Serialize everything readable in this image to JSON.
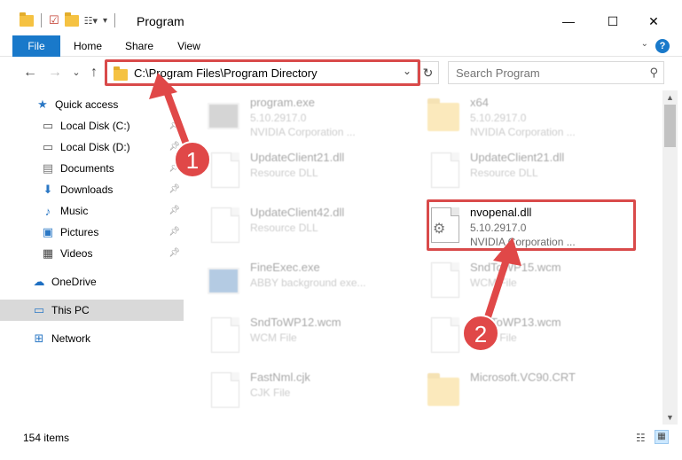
{
  "window": {
    "title": "Program",
    "minimize": "—",
    "maximize": "☐",
    "close": "✕"
  },
  "ribbon": {
    "tabs": [
      {
        "label": "File"
      },
      {
        "label": "Home"
      },
      {
        "label": "Share"
      },
      {
        "label": "View"
      }
    ],
    "help": "?"
  },
  "navigation": {
    "back": "←",
    "forward": "→",
    "recent": "⌄",
    "up": "↑"
  },
  "address_bar": {
    "path": "C:\\Program Files\\Program Directory",
    "refresh": "↻"
  },
  "search": {
    "placeholder": "Search Program"
  },
  "nav_pane": {
    "items": [
      {
        "label": "Quick access",
        "icon": "star-icon",
        "pinned": false
      },
      {
        "label": "Local Disk (C:)",
        "icon": "drive-icon",
        "pinned": true
      },
      {
        "label": "Local Disk (D:)",
        "icon": "drive-icon",
        "pinned": true
      },
      {
        "label": "Documents",
        "icon": "document-icon",
        "pinned": true
      },
      {
        "label": "Downloads",
        "icon": "download-icon",
        "pinned": true
      },
      {
        "label": "Music",
        "icon": "music-icon",
        "pinned": true
      },
      {
        "label": "Pictures",
        "icon": "pictures-icon",
        "pinned": true
      },
      {
        "label": "Videos",
        "icon": "video-icon",
        "pinned": true
      },
      {
        "label": "OneDrive",
        "icon": "cloud-icon",
        "pinned": false
      },
      {
        "label": "This PC",
        "icon": "computer-icon",
        "pinned": false,
        "selected": true
      },
      {
        "label": "Network",
        "icon": "network-icon",
        "pinned": false
      }
    ]
  },
  "files": [
    {
      "name": "program.exe",
      "line2": "5.10.2917.0",
      "line3": "NVIDIA Corporation ...",
      "icon": "exe-icon",
      "faded": true
    },
    {
      "name": "x64",
      "line2": "5.10.2917.0",
      "line3": "NVIDIA Corporation ...",
      "icon": "folder-icon",
      "faded": true
    },
    {
      "name": "UpdateClient21.dll",
      "line2": "Resource DLL",
      "line3": "",
      "icon": "dll-icon",
      "faded": true
    },
    {
      "name": "UpdateClient21.dll",
      "line2": "Resource DLL",
      "line3": "",
      "icon": "dll-icon",
      "faded": true
    },
    {
      "name": "UpdateClient42.dll",
      "line2": "Resource DLL",
      "line3": "",
      "icon": "dll-icon",
      "faded": true
    },
    {
      "name": "nvopenal.dll",
      "line2": "5.10.2917.0",
      "line3": "NVIDIA Corporation ...",
      "icon": "dll-gears-icon",
      "faded": false
    },
    {
      "name": "FineExec.exe",
      "line2": "ABBY background exe...",
      "line3": "",
      "icon": "app-icon",
      "faded": true
    },
    {
      "name": "SndToWP15.wcm",
      "line2": "WCM File",
      "line3": "",
      "icon": "file-icon",
      "faded": true
    },
    {
      "name": "SndToWP12.wcm",
      "line2": "WCM File",
      "line3": "",
      "icon": "file-icon",
      "faded": true
    },
    {
      "name": "SndToWP13.wcm",
      "line2": "WCM File",
      "line3": "",
      "icon": "file-icon",
      "faded": true
    },
    {
      "name": "FastNml.cjk",
      "line2": "CJK File",
      "line3": "",
      "icon": "file-icon",
      "faded": true
    },
    {
      "name": "Microsoft.VC90.CRT",
      "line2": "",
      "line3": "",
      "icon": "folder-icon",
      "faded": true
    }
  ],
  "status_bar": {
    "item_count": "154 items"
  },
  "annotations": {
    "step1": "1",
    "step2": "2",
    "color": "#e04848"
  }
}
